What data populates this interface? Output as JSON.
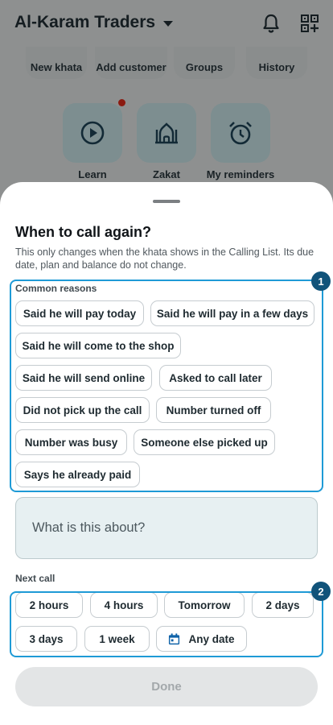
{
  "background": {
    "shop_name": "Al-Karam Traders",
    "top_actions": [
      "New khata",
      "Add customer",
      "Groups",
      "History"
    ],
    "tiles": [
      "Learn",
      "Zakat",
      "My reminders"
    ]
  },
  "sheet": {
    "title": "When to call again?",
    "description": "This only changes when the khata shows in the Calling List. Its due date, plan and balance do not change.",
    "reasons_label": "Common reasons",
    "reasons": [
      "Said he will pay today",
      "Said he will pay in a few days",
      "Said he will come to the shop",
      "Said he will send online",
      "Asked to call later",
      "Did not pick up the call",
      "Number turned off",
      "Number was busy",
      "Someone else picked up",
      "Says he already paid"
    ],
    "note_placeholder": "What is this about?",
    "next_call_label": "Next call",
    "next_call_options": [
      "2 hours",
      "4 hours",
      "Tomorrow",
      "2 days",
      "3 days",
      "1 week",
      "Any date"
    ],
    "done_label": "Done"
  },
  "annotations": [
    "1",
    "2"
  ],
  "colors": {
    "highlight": "#1e9ad6",
    "badge": "#11537a",
    "textbox_bg": "#e7f0f2"
  }
}
